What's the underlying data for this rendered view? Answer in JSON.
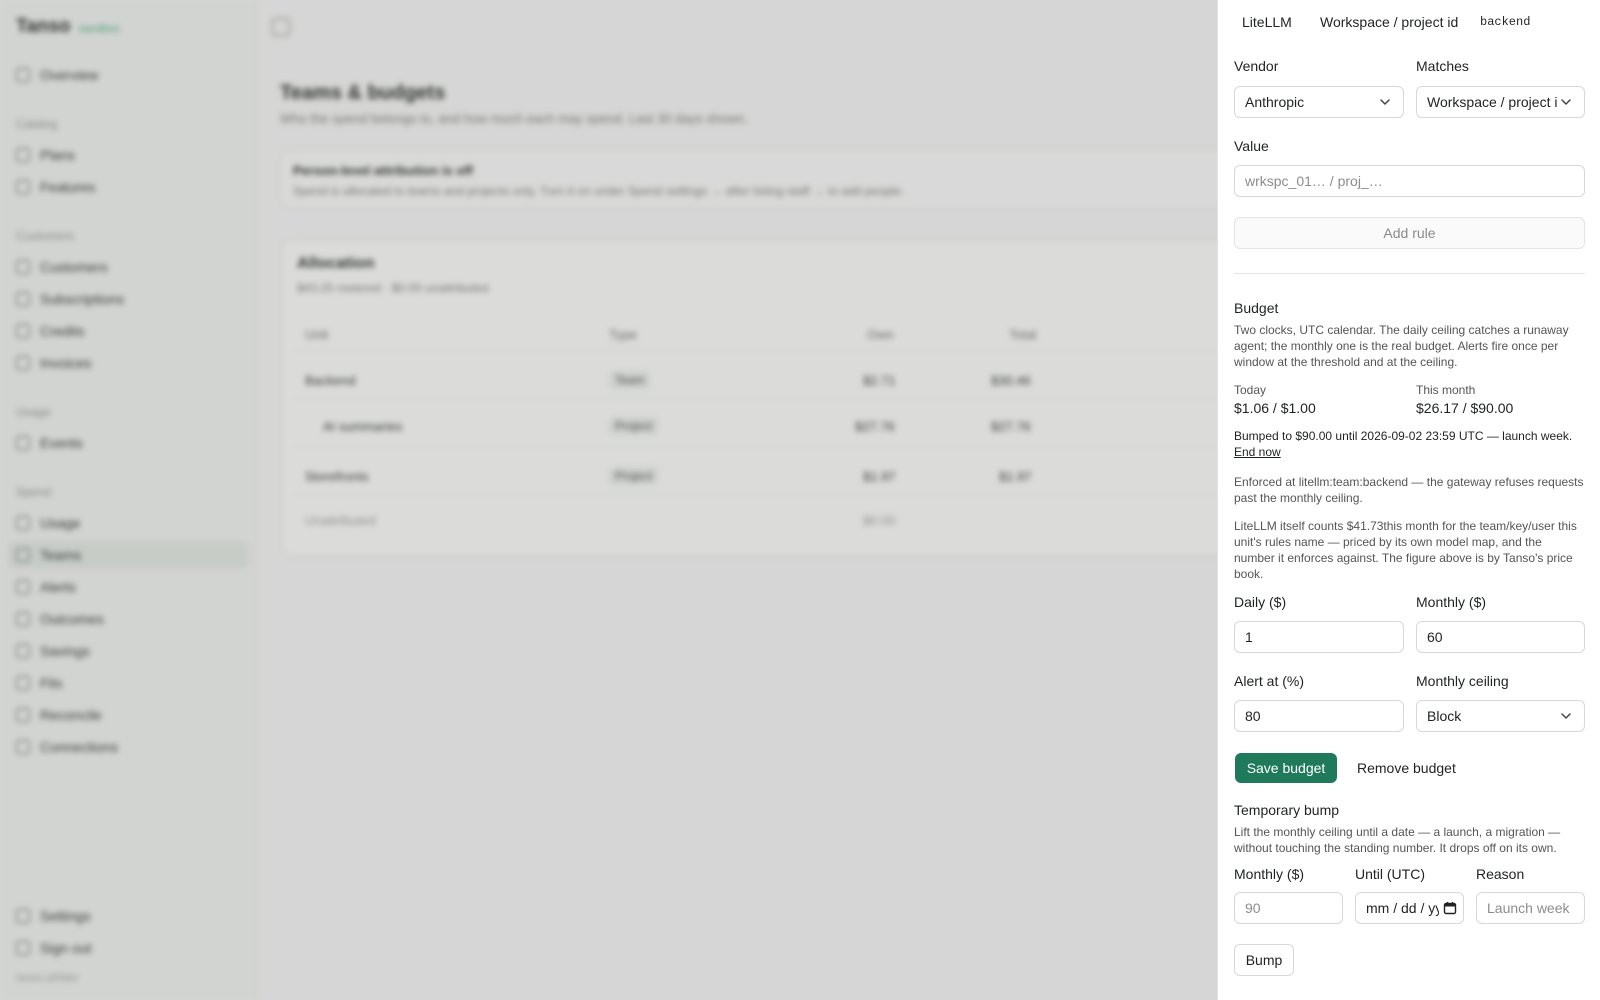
{
  "app": {
    "brand": "Tanso",
    "brand_tag": "sandbox",
    "domain": "tanso.ai/fake"
  },
  "sidebar": {
    "overview": "Overview",
    "sections": [
      {
        "label": "Catalog",
        "items": [
          "Plans",
          "Features"
        ]
      },
      {
        "label": "Customers",
        "items": [
          "Customers",
          "Subscriptions",
          "Credits",
          "Invoices"
        ]
      },
      {
        "label": "Usage",
        "items": [
          "Events"
        ]
      },
      {
        "label": "Spend",
        "items": [
          "Usage",
          "Teams",
          "Alerts",
          "Outcomes",
          "Savings",
          "Fits",
          "Reconcile",
          "Connections"
        ]
      }
    ],
    "bottom": [
      "Settings",
      "Sign out"
    ]
  },
  "main": {
    "title": "Teams & budgets",
    "subtitle": "Who the spend belongs to, and how much each may spend. Last 30 days shown.",
    "notice": {
      "title": "Person-level attribution is off",
      "body": "Spend is allocated to teams and projects only. Turn it on under Spend settings → after listing staff → to add people."
    },
    "allocation": {
      "title": "Allocation",
      "subtitle": "$43.25 metered · $0.00 unattributed",
      "columns": [
        "Unit",
        "Type",
        "Own",
        "Total"
      ],
      "rows": [
        {
          "unit": "Backend",
          "type": "Team",
          "own": "$2.71",
          "total": "$30.46"
        },
        {
          "unit": "AI summaries",
          "type": "Project",
          "own": "$27.76",
          "total": "$27.76"
        },
        {
          "unit": "Storefronts",
          "type": "Project",
          "own": "$1.97",
          "total": "$1.97"
        },
        {
          "unit": "Unattributed",
          "type": "",
          "own": "$0.00",
          "total": ""
        }
      ]
    }
  },
  "panel": {
    "rule_chip": {
      "vendor": "LiteLLM",
      "field": "Workspace / project id",
      "value": "backend"
    },
    "vendor": {
      "label": "Vendor",
      "selected": "Anthropic"
    },
    "matches": {
      "label": "Matches",
      "selected": "Workspace / project id"
    },
    "value": {
      "label": "Value",
      "placeholder": "wrkspc_01… / proj_…"
    },
    "add_rule": "Add rule",
    "budget": {
      "title": "Budget",
      "description": "Two clocks, UTC calendar. The daily ceiling catches a runaway agent; the monthly one is the real budget. Alerts fire once per window at the threshold and at the ceiling.",
      "today_label": "Today",
      "today_value": "$1.06 / $1.00",
      "month_label": "This month",
      "month_value": "$26.17 / $90.00",
      "bump_note": "Bumped to $90.00 until 2026-09-02 23:59 UTC — launch week.",
      "end_now": "End now",
      "enforced": "Enforced at litellm:team:backend — the gateway refuses requests past the monthly ceiling.",
      "litellm_note": "LiteLLM itself counts $41.73this month for the team/key/user this unit's rules name — priced by its own model map, and the number it enforces against. The figure above is by Tanso's price book.",
      "daily_label": "Daily ($)",
      "daily_value": "1",
      "monthly_label": "Monthly ($)",
      "monthly_value": "60",
      "alert_label": "Alert at (%)",
      "alert_value": "80",
      "ceiling_label": "Monthly ceiling",
      "ceiling_value": "Block",
      "save": "Save budget",
      "remove": "Remove budget"
    },
    "bump": {
      "title": "Temporary bump",
      "description": "Lift the monthly ceiling until a date — a launch, a migration — without touching the standing number. It drops off on its own.",
      "monthly_label": "Monthly ($)",
      "monthly_placeholder": "90",
      "until_label": "Until (UTC)",
      "until_placeholder": "mm / dd / yyyy",
      "reason_label": "Reason",
      "reason_placeholder": "Launch week",
      "button": "Bump"
    }
  }
}
